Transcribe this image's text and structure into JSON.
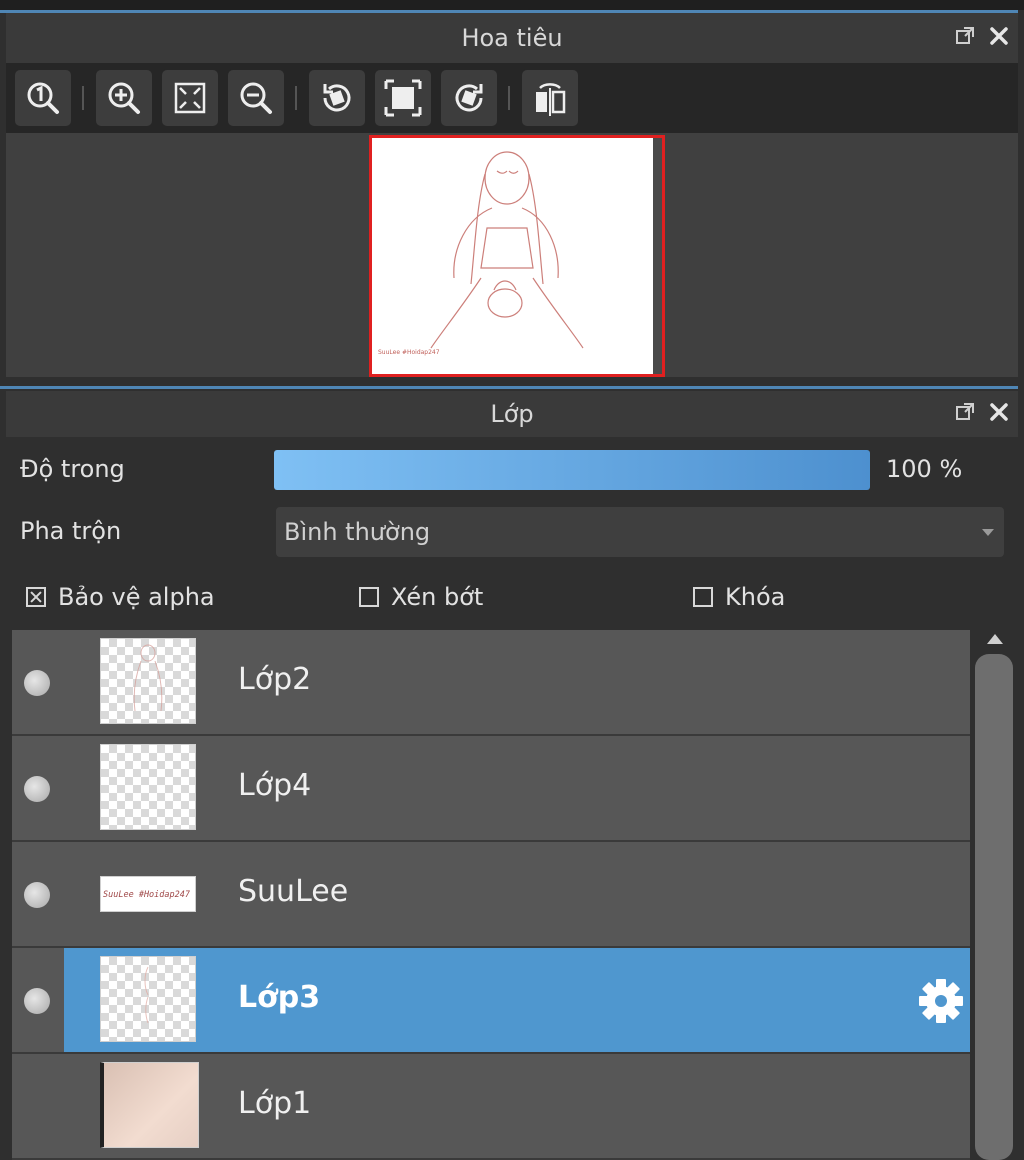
{
  "navigator": {
    "title": "Hoa tiêu",
    "toolbar": [
      {
        "icon": "zoom-actual-size-icon"
      },
      {
        "icon": "zoom-in-icon"
      },
      {
        "icon": "fit-to-window-icon"
      },
      {
        "icon": "zoom-out-icon"
      },
      {
        "icon": "rotate-left-icon"
      },
      {
        "icon": "reset-view-icon"
      },
      {
        "icon": "rotate-right-icon"
      },
      {
        "icon": "flip-horizontal-icon"
      }
    ],
    "preview_signature": "SuuLee #Hoidap247"
  },
  "layers": {
    "title": "Lớp",
    "opacity_label": "Độ trong",
    "opacity_value": 100,
    "opacity_text": "100 %",
    "blend_label": "Pha trộn",
    "blend_value": "Bình thường",
    "checkboxes": [
      {
        "label": "Bảo vệ alpha",
        "checked": true
      },
      {
        "label": "Xén bớt",
        "checked": false
      },
      {
        "label": "Khóa",
        "checked": false
      }
    ],
    "items": [
      {
        "name": "Lớp2",
        "selected": false,
        "visible": true
      },
      {
        "name": "Lớp4",
        "selected": false,
        "visible": true
      },
      {
        "name": "SuuLee",
        "selected": false,
        "visible": true,
        "thumb_text": "SuuLee #Hoidap247"
      },
      {
        "name": "Lớp3",
        "selected": true,
        "visible": true
      },
      {
        "name": "Lớp1",
        "selected": false,
        "visible": false
      }
    ]
  },
  "colors": {
    "accent": "#4f97cf",
    "preview_border": "#e02020",
    "line_art": "#c0605a"
  }
}
